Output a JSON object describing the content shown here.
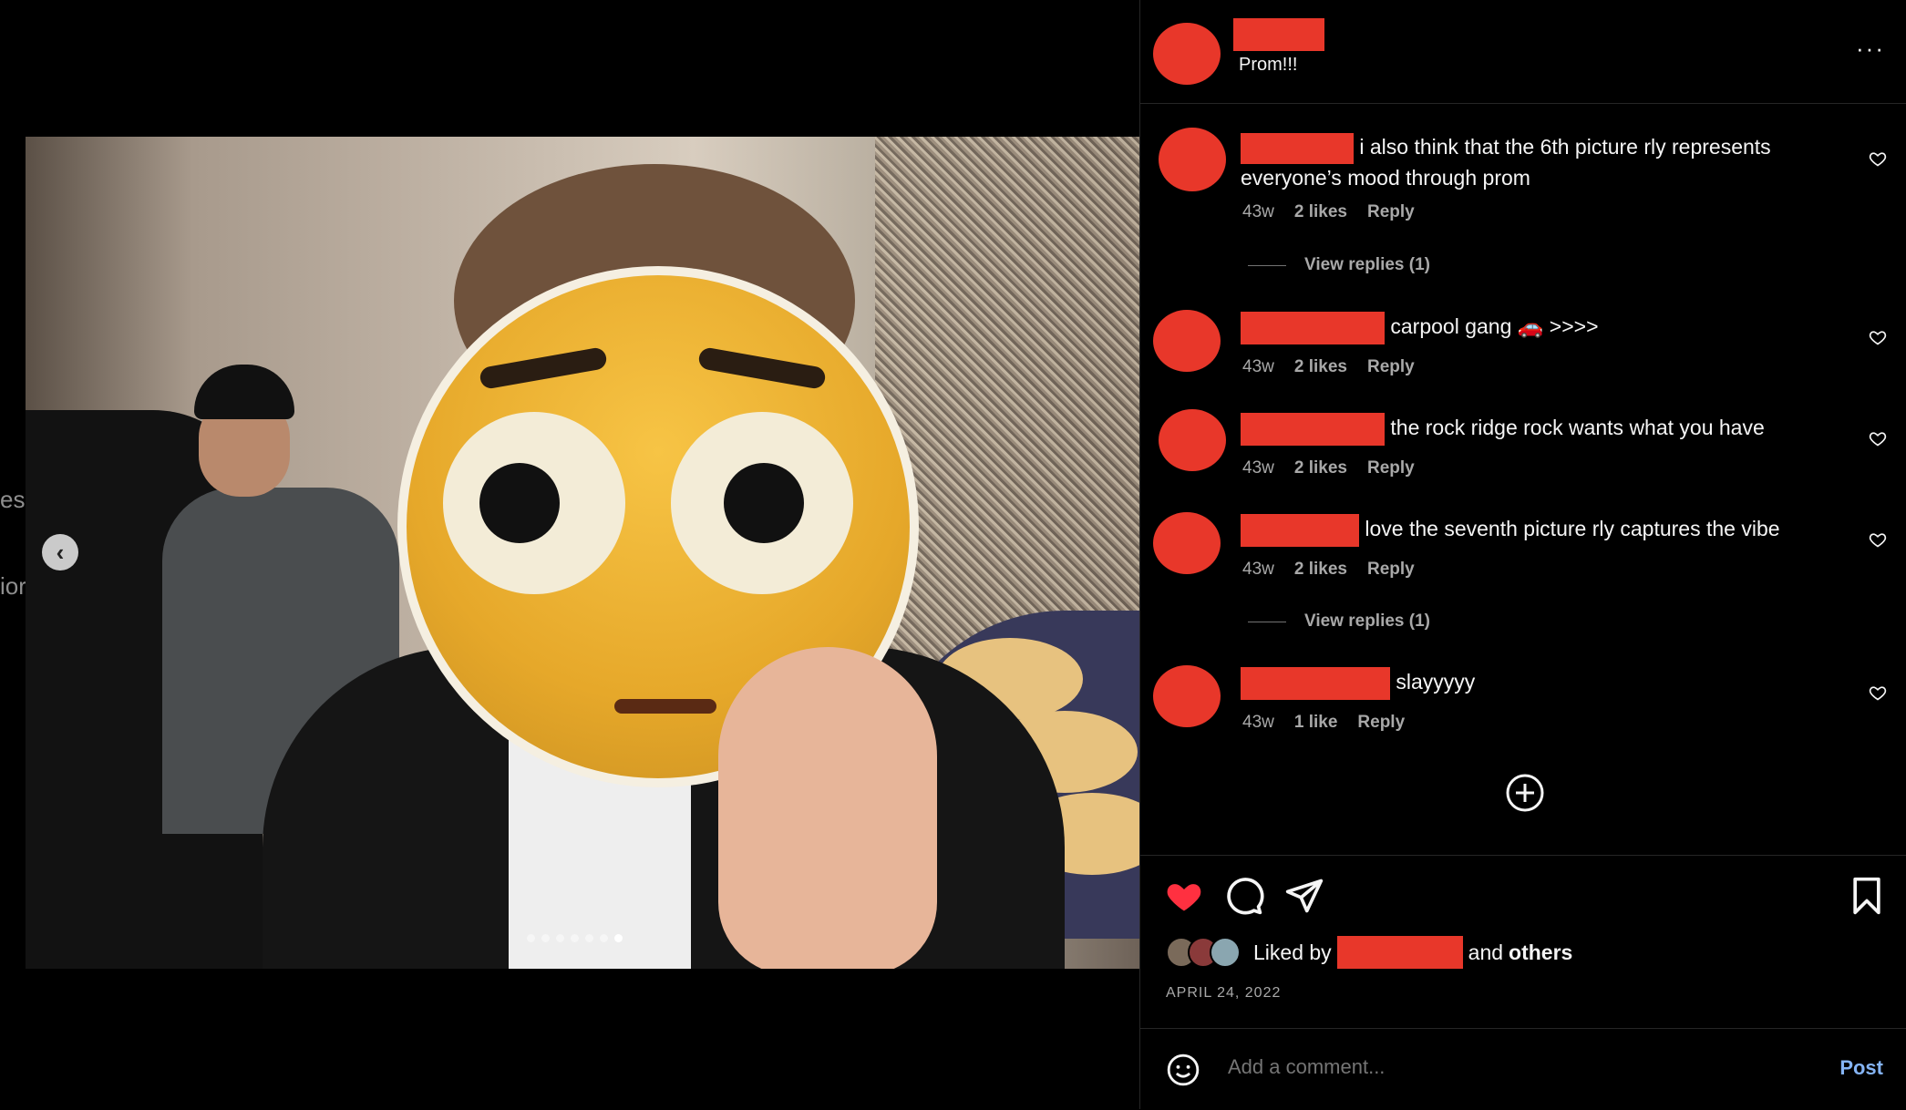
{
  "post": {
    "caption": "Prom!!!",
    "more_label": "···",
    "carousel": {
      "total": 7,
      "active_index": 6
    }
  },
  "left_edge": {
    "fragment_1": "es",
    "fragment_2": "ior"
  },
  "comments": [
    {
      "text": "i also think that the 6th picture rly represents everyone’s mood through prom",
      "time": "43w",
      "likes": "2 likes",
      "reply": "Reply",
      "replies": "View replies (1)"
    },
    {
      "text": "carpool gang 🚗 >>>>",
      "time": "43w",
      "likes": "2 likes",
      "reply": "Reply"
    },
    {
      "text": "the rock ridge rock wants what you have",
      "time": "43w",
      "likes": "2 likes",
      "reply": "Reply"
    },
    {
      "text": "love the seventh picture rly captures the vibe",
      "time": "43w",
      "likes": "2 likes",
      "reply": "Reply",
      "replies": "View replies (1)"
    },
    {
      "text": "slayyyyy",
      "time": "43w",
      "likes": "1 like",
      "reply": "Reply"
    }
  ],
  "likes": {
    "prefix": "Liked by",
    "middle": "and",
    "suffix": "others"
  },
  "date": "APRIL 24, 2022",
  "comment_box": {
    "placeholder": "Add a comment...",
    "post_label": "Post"
  },
  "colors": {
    "redaction": "#e8372a",
    "like_red": "#ff3040",
    "post_blue": "#85b4f5"
  }
}
